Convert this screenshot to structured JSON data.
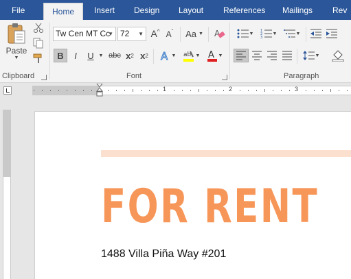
{
  "tabs": [
    {
      "label": "File",
      "active": false
    },
    {
      "label": "Home",
      "active": true
    },
    {
      "label": "Insert",
      "active": false
    },
    {
      "label": "Design",
      "active": false
    },
    {
      "label": "Layout",
      "active": false
    },
    {
      "label": "References",
      "active": false
    },
    {
      "label": "Mailings",
      "active": false
    },
    {
      "label": "Rev",
      "active": false
    }
  ],
  "clipboard": {
    "paste_label": "Paste",
    "group_label": "Clipboard"
  },
  "font": {
    "group_label": "Font",
    "name": "Tw Cen MT Cc",
    "size": "72",
    "change_case_label": "Aa",
    "bold": "B",
    "italic": "I",
    "underline": "U",
    "strikethrough": "abc",
    "subscript_base": "x",
    "subscript_sub": "2",
    "superscript_base": "x",
    "superscript_sup": "2"
  },
  "paragraph": {
    "group_label": "Paragraph"
  },
  "ruler": {
    "numbers": [
      "1",
      "2",
      "3"
    ]
  },
  "document": {
    "headline": "FOR RENT",
    "address": "1488 Villa Piña Way #201"
  },
  "colors": {
    "ribbon_blue": "#2b579a",
    "headline": "#f79659",
    "accent_bar": "#fbdfcf",
    "highlight": "#ffff00",
    "font_color": "#e02020"
  },
  "icons": [
    "cut-icon",
    "copy-icon",
    "format-painter-icon",
    "grow-font-icon",
    "shrink-font-icon",
    "clear-formatting-icon",
    "bullets-icon",
    "numbering-icon",
    "multilevel-list-icon",
    "decrease-indent-icon",
    "increase-indent-icon",
    "text-effects-icon",
    "highlight-icon",
    "font-color-icon",
    "align-left-icon",
    "align-center-icon",
    "align-right-icon",
    "justify-icon",
    "line-spacing-icon",
    "shading-icon"
  ]
}
